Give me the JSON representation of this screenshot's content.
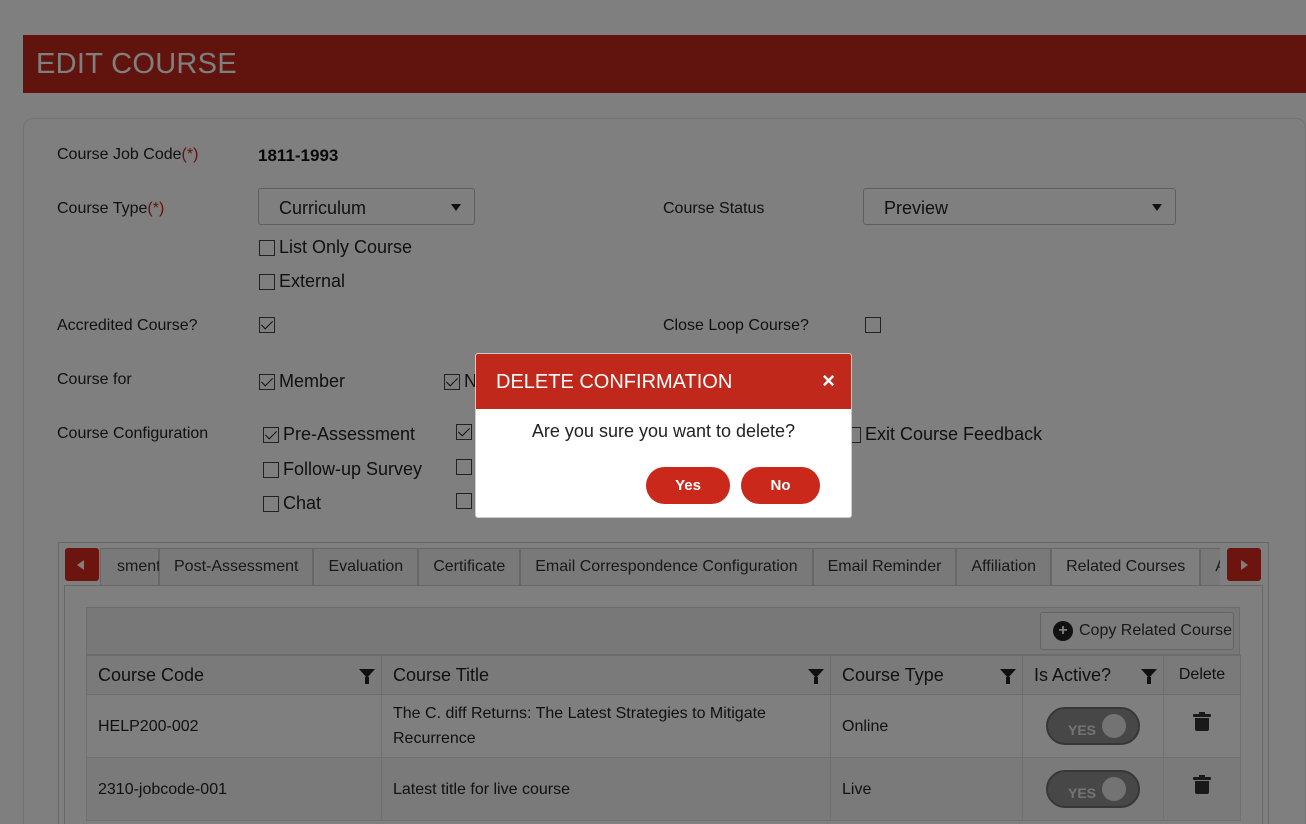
{
  "page": {
    "title": "EDIT COURSE"
  },
  "form": {
    "job_code_label": "Course Job Code",
    "required_mark": "(*)",
    "job_code_value": "1811-1993",
    "course_type_label": "Course Type",
    "course_type_value": "Curriculum",
    "course_status_label": "Course Status",
    "course_status_value": "Preview",
    "list_only_label": "List Only Course",
    "external_label": "External",
    "accredited_label": "Accredited Course?",
    "close_loop_label": "Close Loop Course?",
    "course_for_label": "Course for",
    "member_label": "Member",
    "nonmember_label_fragment": "N",
    "course_config_label": "Course Configuration",
    "pre_assessment_label": "Pre-Assessment",
    "exit_feedback_label": "Exit Course Feedback",
    "followup_label": "Follow-up Survey",
    "chat_label": "Chat"
  },
  "tabs": [
    {
      "label": "sment"
    },
    {
      "label": "Post-Assessment"
    },
    {
      "label": "Evaluation"
    },
    {
      "label": "Certificate"
    },
    {
      "label": "Email Correspondence Configuration"
    },
    {
      "label": "Email Reminder"
    },
    {
      "label": "Affiliation"
    },
    {
      "label": "Related Courses"
    },
    {
      "label": "Asl"
    }
  ],
  "grid": {
    "copy_button": "Copy Related Course",
    "columns": [
      "Course Code",
      "Course Title",
      "Course Type",
      "Is Active?",
      "Delete"
    ],
    "rows": [
      {
        "code": "HELP200-002",
        "title": "The C. diff Returns: The Latest Strategies to Mitigate Recurrence",
        "type": "Online",
        "active": "YES"
      },
      {
        "code": "2310-jobcode-001",
        "title": "Latest title for live course",
        "type": "Live",
        "active": "YES"
      }
    ]
  },
  "modal": {
    "title": "DELETE CONFIRMATION",
    "close": "×",
    "message": "Are you sure you want to delete?",
    "yes": "Yes",
    "no": "No"
  },
  "colors": {
    "brand": "#c0281b",
    "overlay": "rgba(0,0,0,0.5)"
  }
}
